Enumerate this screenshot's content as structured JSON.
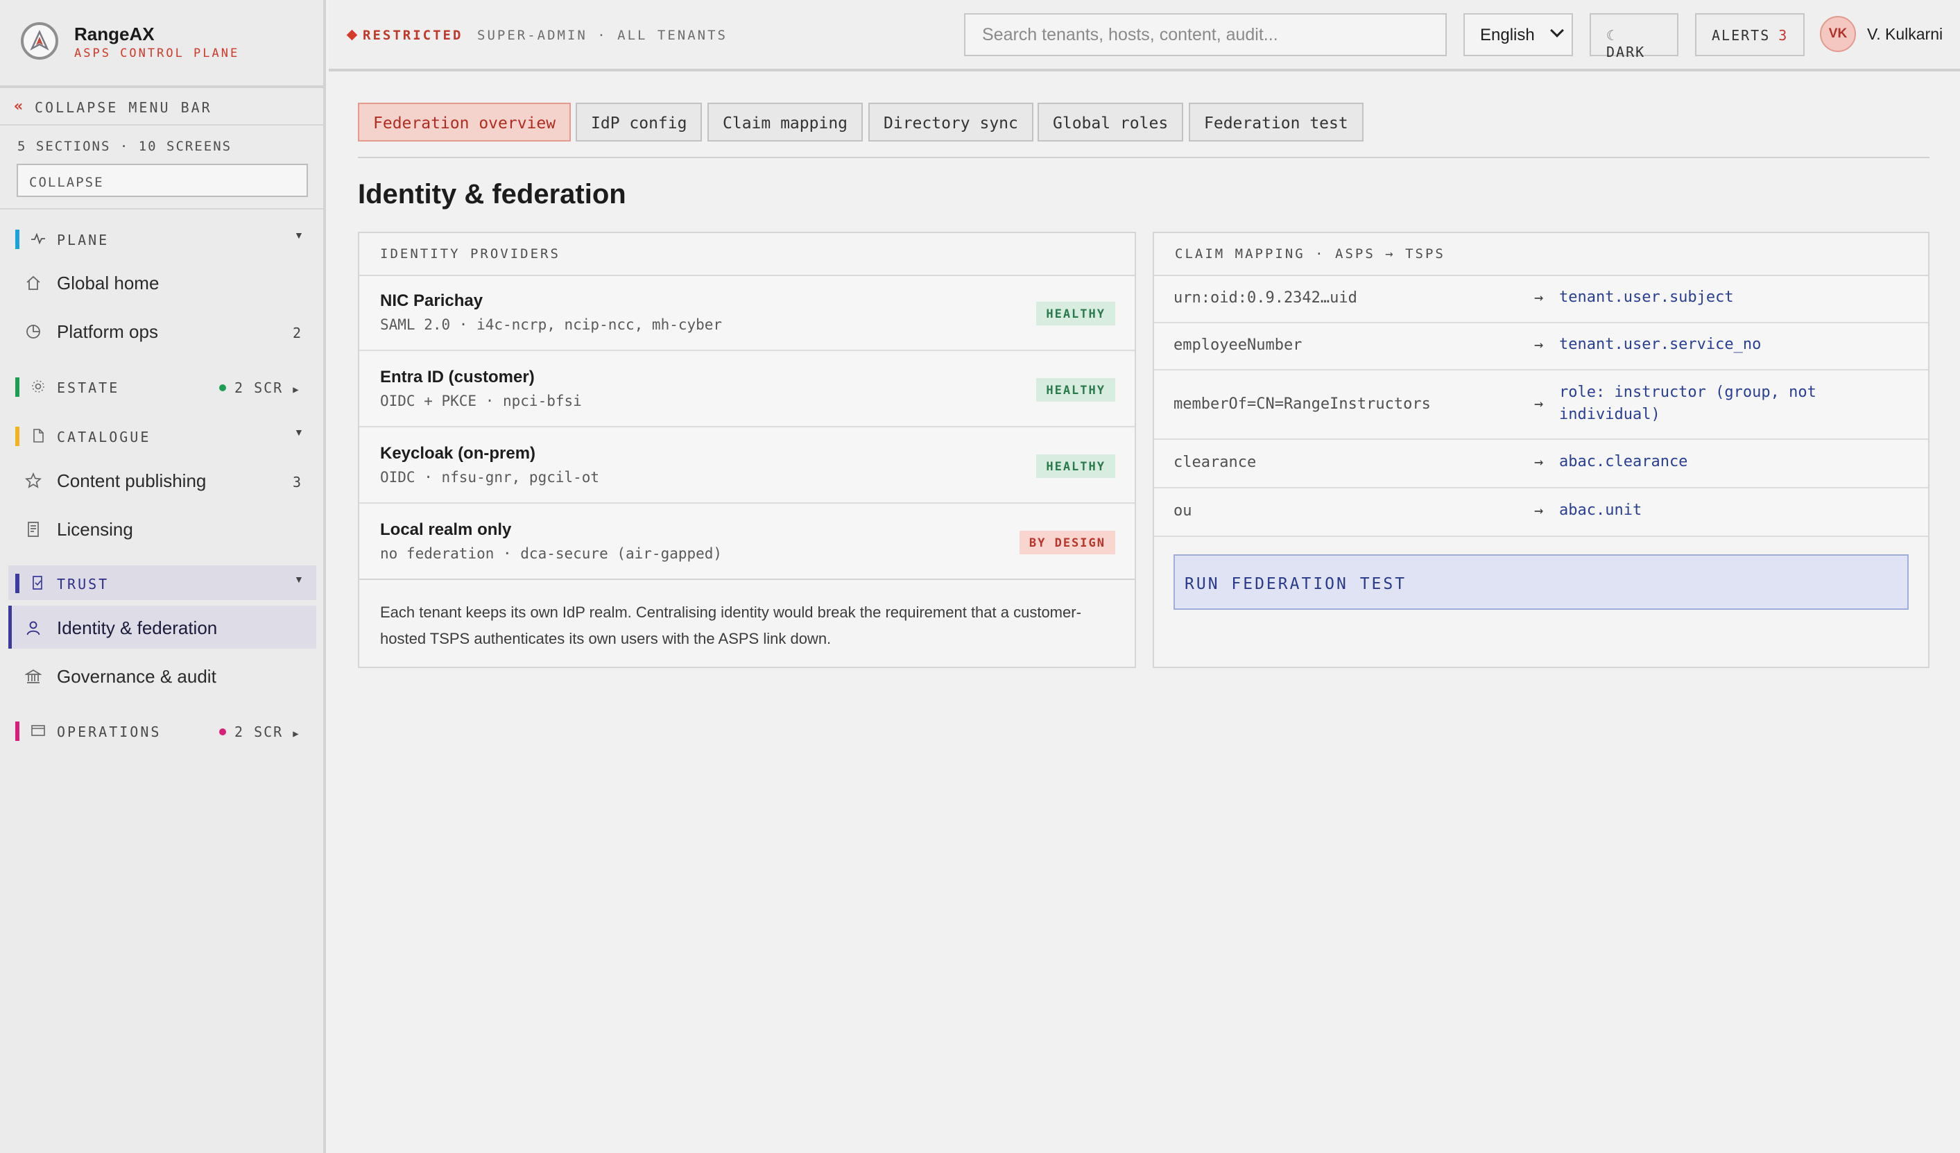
{
  "brand": {
    "name": "RangeAX",
    "subtitle": "ASPS CONTROL PLANE"
  },
  "sidebar": {
    "collapse_label": "COLLAPSE MENU BAR",
    "sections_count": "5 SECTIONS · 10 SCREENS",
    "collapse_input": "COLLAPSE",
    "sections": [
      {
        "name": "PLANE",
        "color": "#1aa3d9",
        "expanded": true,
        "items": [
          {
            "label": "Global home",
            "count": ""
          },
          {
            "label": "Platform ops",
            "count": "2"
          }
        ]
      },
      {
        "name": "ESTATE",
        "color": "#1e9e52",
        "expanded": false,
        "screens": "2 SCR",
        "dot_color": "#1e9e52"
      },
      {
        "name": "CATALOGUE",
        "color": "#f0b323",
        "expanded": true,
        "items": [
          {
            "label": "Content publishing",
            "count": "3"
          },
          {
            "label": "Licensing",
            "count": ""
          }
        ]
      },
      {
        "name": "TRUST",
        "color": "#3b3b9e",
        "expanded": true,
        "active": true,
        "items": [
          {
            "label": "Identity & federation",
            "active": true
          },
          {
            "label": "Governance & audit"
          }
        ]
      },
      {
        "name": "OPERATIONS",
        "color": "#d61f7a",
        "expanded": false,
        "screens": "2 SCR",
        "dot_color": "#d61f7a"
      }
    ]
  },
  "header": {
    "restricted": "RESTRICTED",
    "scope": "SUPER-ADMIN · ALL TENANTS",
    "search_placeholder": "Search tenants, hosts, content, audit...",
    "language": "English",
    "dark_label": "DARK",
    "alerts_label": "ALERTS",
    "alerts_count": "3",
    "user_initials": "VK",
    "user_name": "V. Kulkarni"
  },
  "tabs": [
    "Federation overview",
    "IdP config",
    "Claim mapping",
    "Directory sync",
    "Global roles",
    "Federation test"
  ],
  "page_title": "Identity & federation",
  "identity_providers": {
    "heading": "IDENTITY PROVIDERS",
    "rows": [
      {
        "name": "NIC Parichay",
        "detail": "SAML 2.0 · i4c-ncrp, ncip-ncc, mh-cyber",
        "status": "HEALTHY"
      },
      {
        "name": "Entra ID (customer)",
        "detail": "OIDC + PKCE · npci-bfsi",
        "status": "HEALTHY"
      },
      {
        "name": "Keycloak (on-prem)",
        "detail": "OIDC · nfsu-gnr, pgcil-ot",
        "status": "HEALTHY"
      },
      {
        "name": "Local realm only",
        "detail": "no federation · dca-secure (air-gapped)",
        "status": "BY DESIGN"
      }
    ],
    "note": "Each tenant keeps its own IdP realm. Centralising identity would break the requirement that a customer-hosted TSPS authenticates its own users with the ASPS link down."
  },
  "claim_mapping": {
    "heading": "CLAIM MAPPING · ASPS → TSPS",
    "rows": [
      {
        "source": "urn:oid:0.9.2342…uid",
        "arrow": "→",
        "target": "tenant.user.subject"
      },
      {
        "source": "employeeNumber",
        "arrow": "→",
        "target": "tenant.user.service_no"
      },
      {
        "source": "memberOf=CN=RangeInstructors",
        "arrow": "→",
        "target": "role: instructor (group, not individual)"
      },
      {
        "source": "clearance",
        "arrow": "→",
        "target": "abac.clearance"
      },
      {
        "source": "ou",
        "arrow": "→",
        "target": "abac.unit"
      }
    ],
    "run_button": "RUN FEDERATION TEST"
  }
}
